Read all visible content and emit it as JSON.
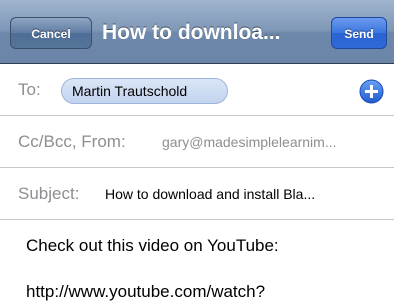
{
  "navbar": {
    "cancel_label": "Cancel",
    "title": "How to downloa...",
    "send_label": "Send"
  },
  "to_field": {
    "label": "To:",
    "recipient": "Martin Trautschold",
    "add_icon": "plus-circle-icon"
  },
  "cc_field": {
    "label": "Cc/Bcc, From:",
    "value": "gary@madesimplelearnim..."
  },
  "subject_field": {
    "label": "Subject:",
    "value": "How to download and install Bla..."
  },
  "message": {
    "line1": "Check out this video on YouTube:",
    "line2": "http://www.youtube.com/watch?"
  },
  "colors": {
    "accent": "#2f6ad8",
    "navbar": "#7f98b7",
    "label_gray": "#8e8e93"
  }
}
